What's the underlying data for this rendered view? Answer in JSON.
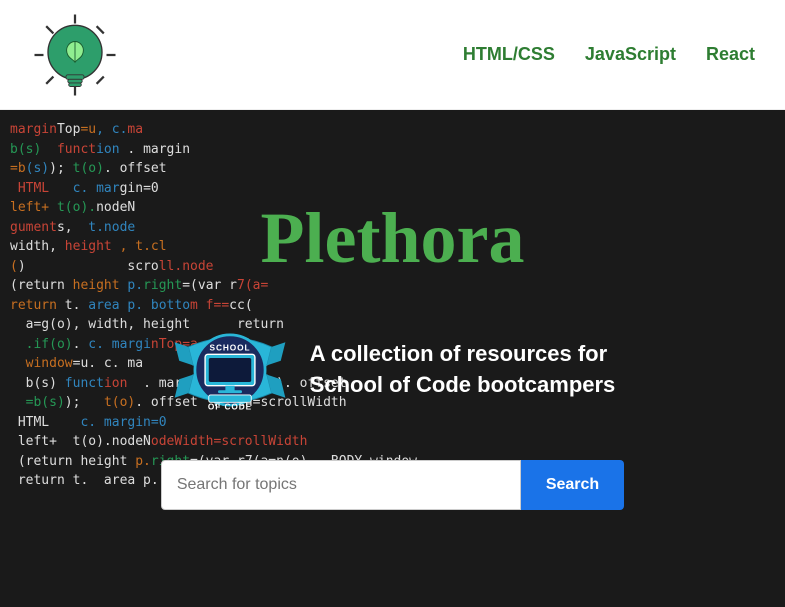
{
  "navbar": {
    "links": [
      {
        "label": "HTML/CSS",
        "id": "html-css"
      },
      {
        "label": "JavaScript",
        "id": "javascript"
      },
      {
        "label": "React",
        "id": "react"
      }
    ]
  },
  "hero": {
    "title": "Plethora",
    "description_line1": "A collection of resources for",
    "description_line2": "School of Code bootcampers",
    "search_placeholder": "Search for topics",
    "search_button_label": "Search"
  },
  "colors": {
    "nav_link": "#2e7d32",
    "title": "#4caf50",
    "search_button_bg": "#1a73e8"
  }
}
